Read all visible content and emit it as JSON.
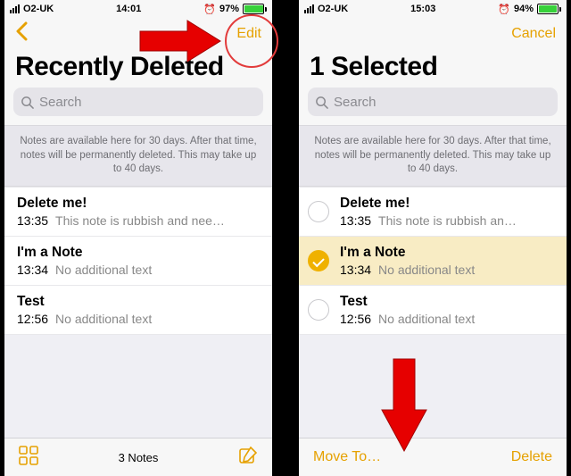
{
  "left": {
    "status": {
      "carrier": "O2-UK",
      "time": "14:01",
      "battery_pct": "97%",
      "battery_fill": 95
    },
    "nav": {
      "action": "Edit"
    },
    "title": "Recently Deleted",
    "search_placeholder": "Search",
    "info": "Notes are available here for 30 days. After that time, notes will be permanently deleted. This may take up to 40 days.",
    "notes": [
      {
        "title": "Delete me!",
        "time": "13:35",
        "preview": "This note is rubbish and nee…"
      },
      {
        "title": "I'm a Note",
        "time": "13:34",
        "preview": "No additional text"
      },
      {
        "title": "Test",
        "time": "12:56",
        "preview": "No additional text"
      }
    ],
    "toolbar": {
      "count": "3 Notes"
    }
  },
  "right": {
    "status": {
      "carrier": "O2-UK",
      "time": "15:03",
      "battery_pct": "94%",
      "battery_fill": 92
    },
    "nav": {
      "action": "Cancel"
    },
    "title": "1 Selected",
    "search_placeholder": "Search",
    "info": "Notes are available here for 30 days. After that time, notes will be permanently deleted. This may take up to 40 days.",
    "notes": [
      {
        "title": "Delete me!",
        "time": "13:35",
        "preview": "This note is rubbish an…",
        "selected": false
      },
      {
        "title": "I'm a Note",
        "time": "13:34",
        "preview": "No additional text",
        "selected": true
      },
      {
        "title": "Test",
        "time": "12:56",
        "preview": "No additional text",
        "selected": false
      }
    ],
    "toolbar": {
      "move": "Move To…",
      "delete": "Delete"
    }
  }
}
